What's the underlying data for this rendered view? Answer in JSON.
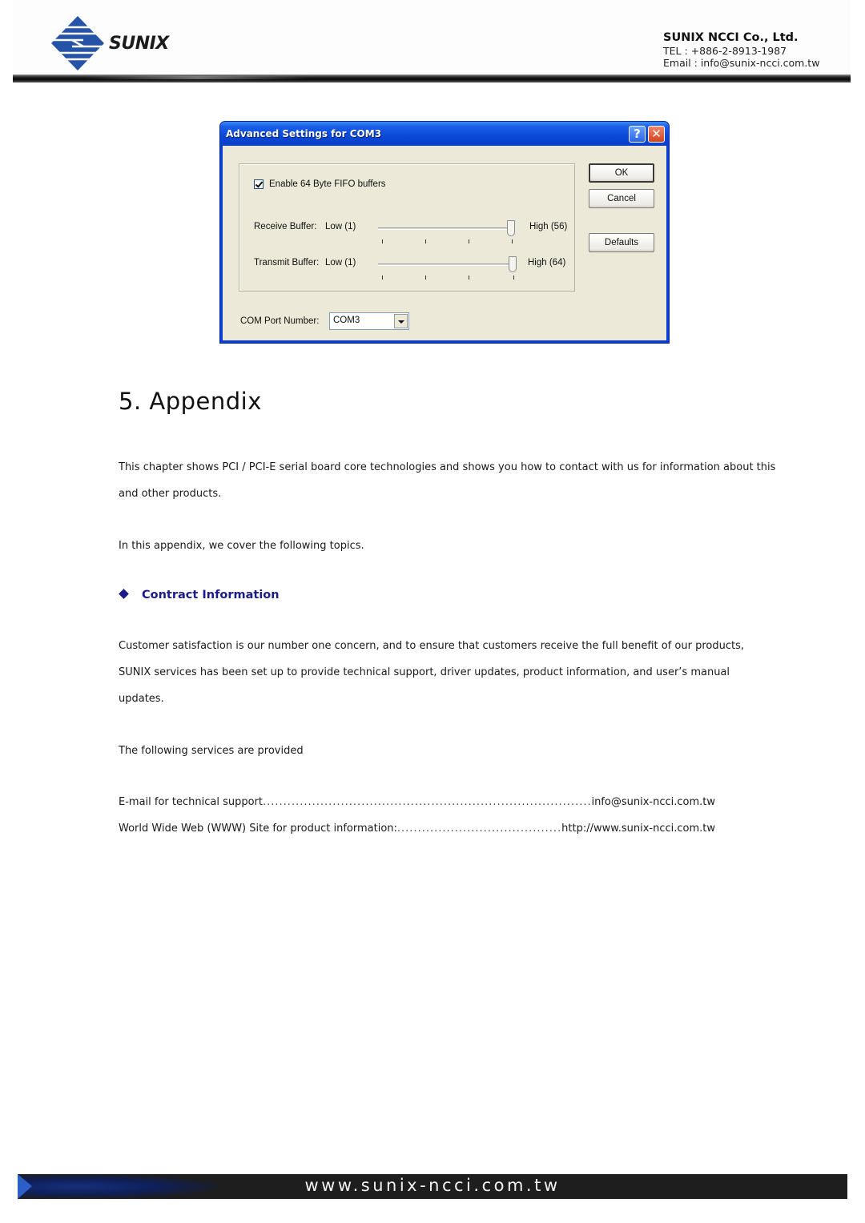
{
  "header": {
    "logo_text": "SUNIX",
    "company_name": "SUNIX NCCI Co., Ltd.",
    "tel": "TEL : +886-2-8913-1987",
    "email": "Email : info@sunix-ncci.com.tw"
  },
  "dialog": {
    "title": "Advanced Settings for COM3",
    "help_label": "?",
    "close_label": "✕",
    "fifo_checkbox": {
      "label": "Enable 64 Byte FIFO buffers",
      "checked": true
    },
    "receive_buffer": {
      "label": "Receive Buffer:",
      "low_label": "Low (1)",
      "high_label": "High (56)",
      "value_fraction": 1.0
    },
    "transmit_buffer": {
      "label": "Transmit Buffer:",
      "low_label": "Low (1)",
      "high_label": "High (64)",
      "value_fraction": 1.0
    },
    "buttons": {
      "ok": "OK",
      "cancel": "Cancel",
      "defaults": "Defaults"
    },
    "com_port": {
      "label": "COM Port Number:",
      "value": "COM3"
    }
  },
  "content": {
    "heading": "5. Appendix",
    "intro": "This chapter shows PCI / PCI-E serial board core technologies and shows you how to contact with us for information about this and other products.",
    "topics_intro": "In this appendix, we cover the following topics.",
    "section_title": "Contract Information",
    "section_body": "Customer satisfaction is our number one concern, and to ensure that customers receive the full benefit of our products, SUNIX services has been set up to provide technical support, driver updates, product information, and user’s manual updates.",
    "services_intro": "The following services are provided",
    "services": [
      {
        "label": "E-mail for technical support",
        "value": "info@sunix-ncci.com.tw"
      },
      {
        "label": "World Wide Web (WWW) Site for product information:",
        "value": "http://www.sunix-ncci.com.tw"
      }
    ]
  },
  "footer": {
    "url": "www.sunix-ncci.com.tw"
  }
}
